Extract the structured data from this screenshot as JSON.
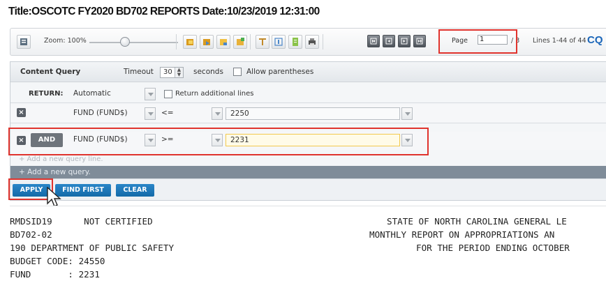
{
  "window": {
    "title": "Title:OSCOTC FY2020 BD702 REPORTS Date:10/23/2019 12:31:00"
  },
  "toolbar": {
    "zoom_label": "Zoom: 100%",
    "zoom_level_percent": 100,
    "page_label": "Page",
    "page_value": "1",
    "page_total": "/ 3",
    "lines_label": "Lines 1-44 of 44",
    "cq_label": "CQ",
    "icons": [
      "report-icon",
      "folder-open-icon",
      "folder-export-icon",
      "image-icon",
      "add-image-icon",
      "column-icon",
      "text-icon",
      "document-icon",
      "print-icon",
      "first-page-icon",
      "prev-page-icon",
      "next-page-icon",
      "last-page-icon"
    ]
  },
  "content_query": {
    "title": "Content Query",
    "timeout_label": "Timeout",
    "timeout_value": "30",
    "timeout_unit": "seconds",
    "allow_parentheses_label": "Allow parentheses",
    "return_label": "RETURN:",
    "return_value": "Automatic",
    "return_additional_label": "Return additional lines",
    "rows": [
      {
        "connector": "",
        "field": "FUND (FUND$)",
        "operator": "<=",
        "value": "2250"
      },
      {
        "connector": "AND",
        "field": "FUND (FUND$)",
        "operator": ">=",
        "value": "2231"
      }
    ],
    "add_line_label": "+ Add a new query line.",
    "add_query_label": "+ Add a new query.",
    "buttons": {
      "apply": "APPLY",
      "find_first": "FIND FIRST",
      "clear": "CLEAR"
    }
  },
  "report": {
    "left_lines": [
      "RMDSID19      NOT CERTIFIED",
      "BD702-02",
      "190 DEPARTMENT OF PUBLIC SAFETY",
      "BUDGET CODE: 24550",
      "FUND       : 2231"
    ],
    "right_lines": [
      "STATE OF NORTH CAROLINA GENERAL LE",
      "MONTHLY REPORT ON APPROPRIATIONS AN",
      "FOR THE PERIOD ENDING OCTOBER"
    ]
  },
  "colors": {
    "accent": "#1b66b9",
    "highlight": "#e0332d",
    "button": "#1a77bb"
  }
}
